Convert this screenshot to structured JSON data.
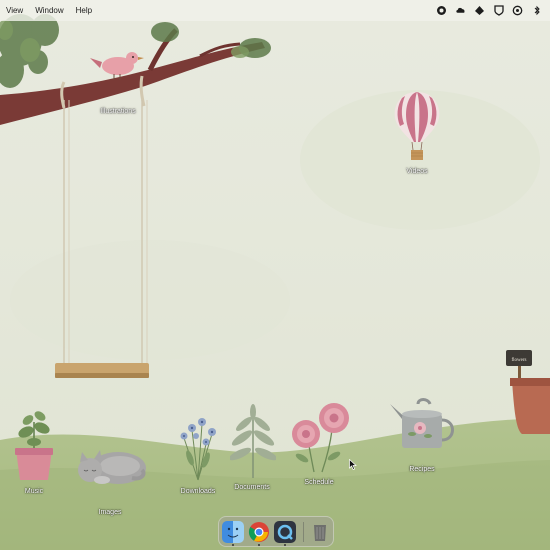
{
  "menubar": {
    "items": [
      "View",
      "Window",
      "Help"
    ],
    "status_icons": [
      "record-icon",
      "cloud-icon",
      "vpn-icon",
      "shield-icon",
      "sync-icon",
      "bluetooth-icon"
    ]
  },
  "desktop_icons": {
    "illustrations": "Illustrations",
    "videos": "Videos",
    "music": "Music",
    "images": "Images",
    "downloads": "Downloads",
    "documents": "Documents",
    "schedule": "Schedule",
    "recipes": "Recipes"
  },
  "wallpaper": {
    "sign_text": "flowers",
    "colors": {
      "sky": "#e6e8dc",
      "grass": "#a4b77e",
      "branch": "#7a3a36",
      "balloon": "#c9748a"
    }
  },
  "dock": {
    "apps": [
      "finder-icon",
      "chrome-icon",
      "quicktime-icon",
      "trash-icon"
    ]
  }
}
